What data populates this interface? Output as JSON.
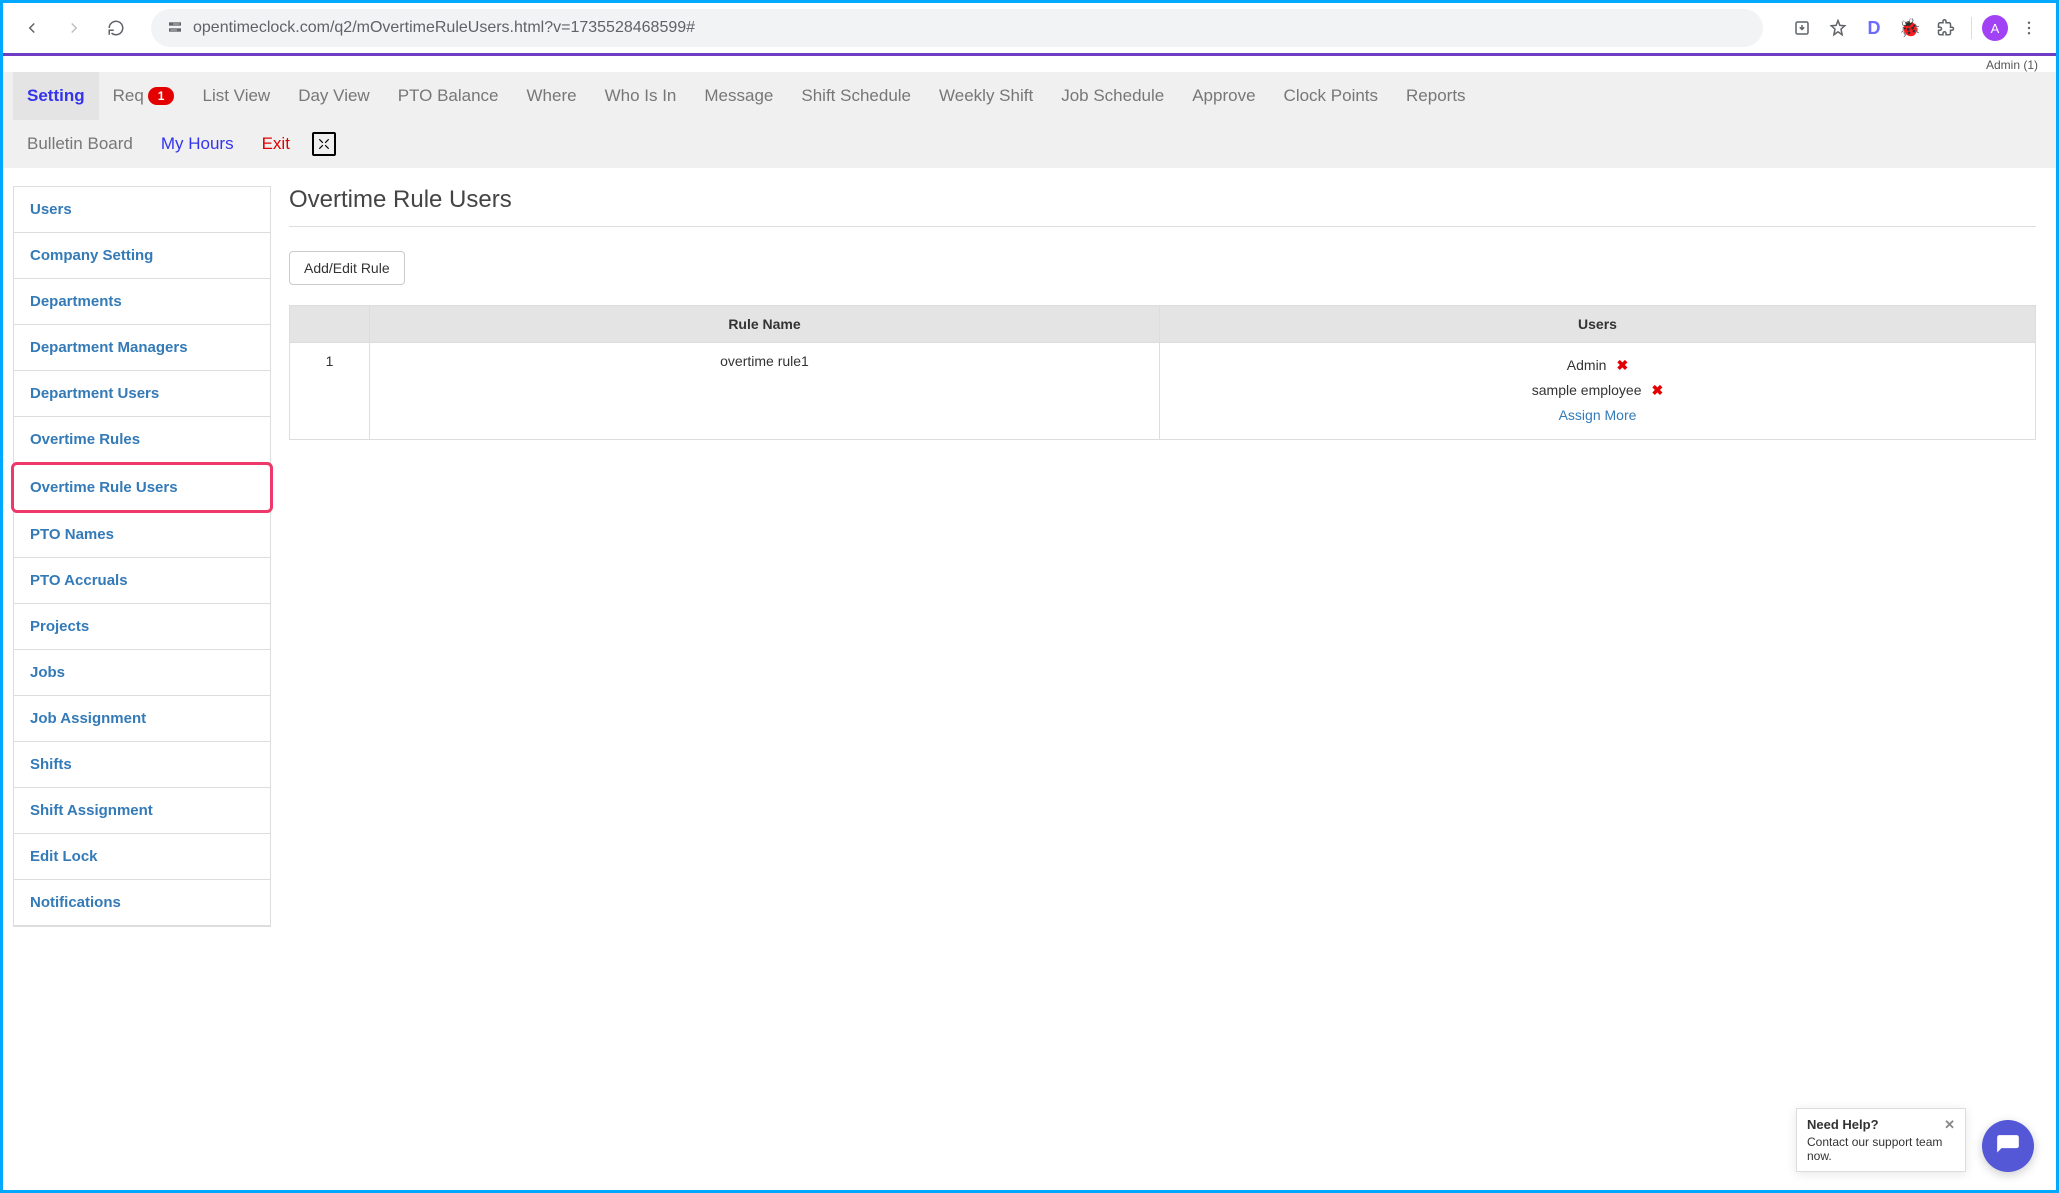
{
  "browser": {
    "url_display": "opentimeclock.com/q2/mOvertimeRuleUsers.html?v=1735528468599#",
    "avatar_letter": "A",
    "ext_d": "D"
  },
  "header": {
    "user_line": "Admin (1)"
  },
  "topnav": {
    "row1": [
      {
        "label": "Setting",
        "active": true
      },
      {
        "label": "Req",
        "badge": "1"
      },
      {
        "label": "List View"
      },
      {
        "label": "Day View"
      },
      {
        "label": "PTO Balance"
      },
      {
        "label": "Where"
      },
      {
        "label": "Who Is In"
      },
      {
        "label": "Message"
      },
      {
        "label": "Shift Schedule"
      },
      {
        "label": "Weekly Shift"
      },
      {
        "label": "Job Schedule"
      },
      {
        "label": "Approve"
      },
      {
        "label": "Clock Points"
      },
      {
        "label": "Reports"
      }
    ],
    "row2": [
      {
        "label": "Bulletin Board"
      },
      {
        "label": "My Hours",
        "style": "blue"
      },
      {
        "label": "Exit",
        "style": "red"
      }
    ]
  },
  "sidebar": {
    "items": [
      {
        "label": "Users"
      },
      {
        "label": "Company Setting"
      },
      {
        "label": "Departments"
      },
      {
        "label": "Department Managers"
      },
      {
        "label": "Department Users"
      },
      {
        "label": "Overtime Rules"
      },
      {
        "label": "Overtime Rule Users",
        "highlighted": true
      },
      {
        "label": "PTO Names"
      },
      {
        "label": "PTO Accruals"
      },
      {
        "label": "Projects"
      },
      {
        "label": "Jobs"
      },
      {
        "label": "Job Assignment"
      },
      {
        "label": "Shifts"
      },
      {
        "label": "Shift Assignment"
      },
      {
        "label": "Edit Lock"
      },
      {
        "label": "Notifications"
      }
    ]
  },
  "main": {
    "title": "Overtime Rule Users",
    "add_edit_btn": "Add/Edit Rule",
    "columns": {
      "idx": "",
      "rule": "Rule Name",
      "users": "Users"
    },
    "rows": [
      {
        "idx": "1",
        "rule_name": "overtime rule1",
        "users": [
          "Admin",
          "sample employee"
        ],
        "assign_more": "Assign More"
      }
    ]
  },
  "help": {
    "title": "Need Help?",
    "subtitle": "Contact our support team now."
  }
}
